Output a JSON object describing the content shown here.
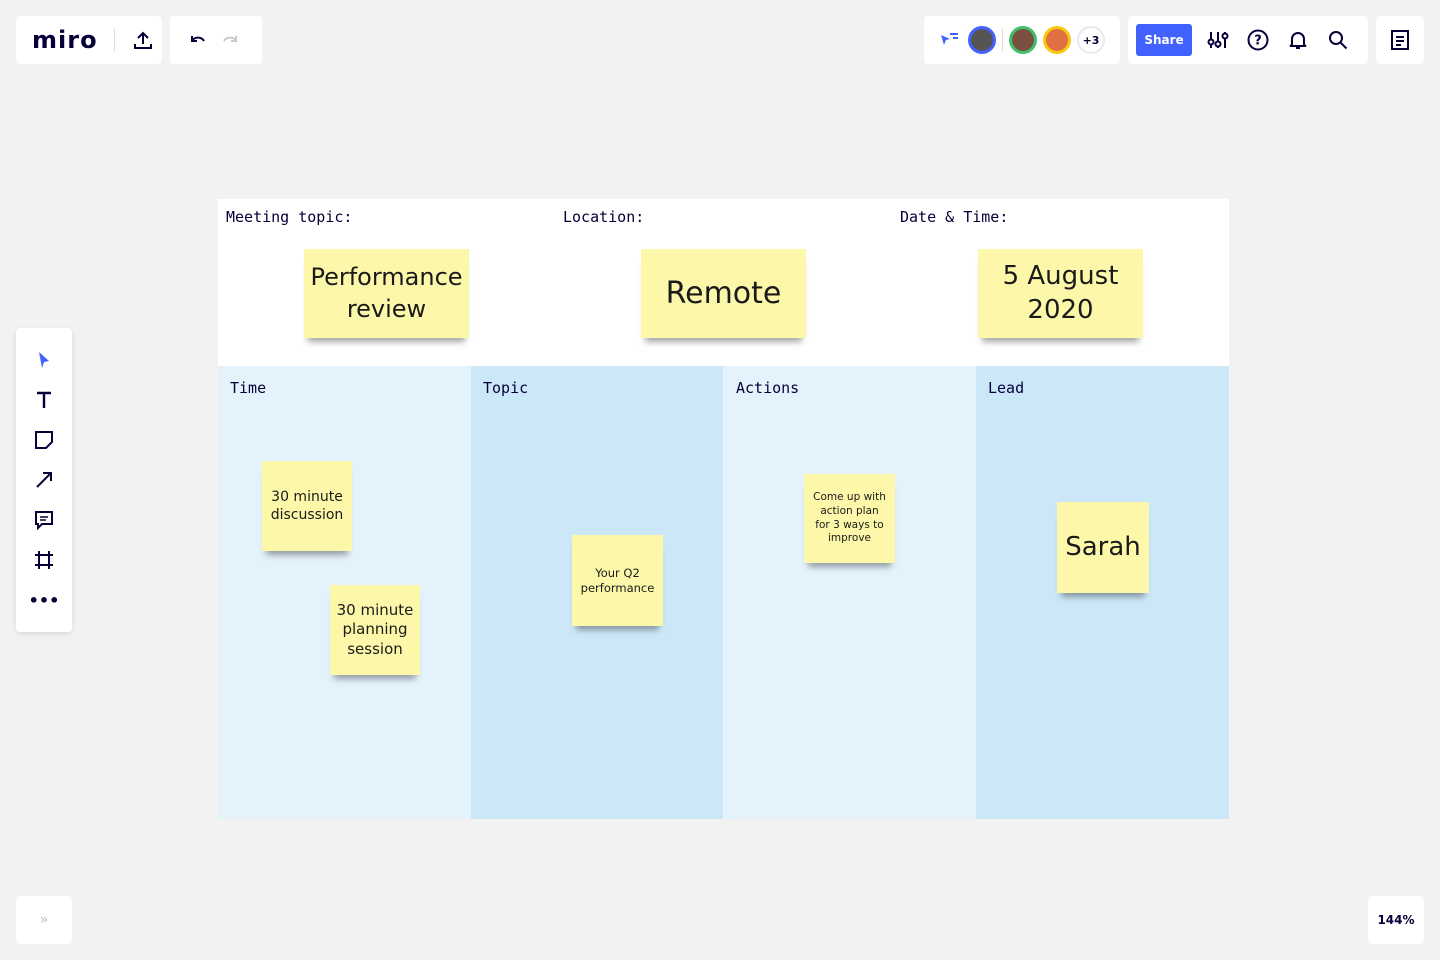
{
  "toolbar": {
    "logo": "miro",
    "share_label": "Share",
    "more_users": "+3",
    "zoom": "144%"
  },
  "board": {
    "header": {
      "meeting_topic_label": "Meeting topic:",
      "location_label": "Location:",
      "date_label": "Date & Time:",
      "meeting_topic": "Performance review",
      "location": "Remote",
      "date": "5 August 2020"
    },
    "columns": [
      {
        "title": "Time",
        "color": "#e3f2fb"
      },
      {
        "title": "Topic",
        "color": "#cce8f8"
      },
      {
        "title": "Actions",
        "color": "#e3f2fb"
      },
      {
        "title": "Lead",
        "color": "#cce8f8"
      }
    ],
    "stickies": {
      "time1": "30 minute discussion",
      "time2": "30 minute planning session",
      "topic": "Your Q2 performance",
      "actions": "Come up with action plan for 3 ways to improve",
      "lead": "Sarah"
    }
  },
  "colors": {
    "accent": "#4262ff",
    "sticky": "#fdf8a9"
  }
}
